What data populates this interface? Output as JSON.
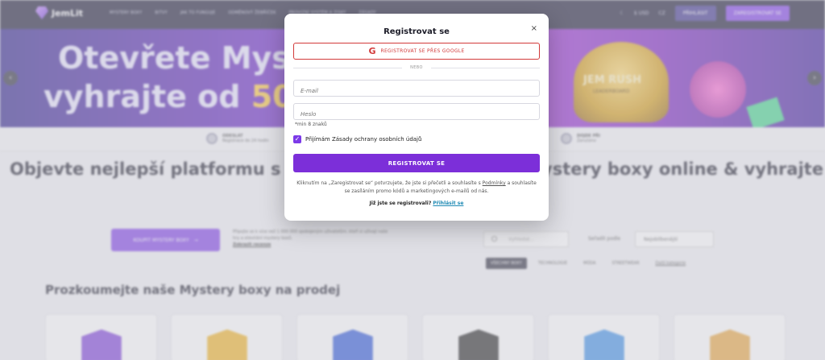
{
  "nav": {
    "logo_text": "JemLit",
    "items": [
      "Mystery boxy",
      "Bitvy",
      "Jak to funguje",
      "Odměnový žebříček",
      "Provizní systém a zisky",
      "Zásady"
    ],
    "currency": "$ USD",
    "language": "CZ",
    "login_label": "PŘIHLÁSIT",
    "register_label": "ZAREGISTROVAT SE"
  },
  "hero": {
    "line1": "Otevřete Myst",
    "line2_prefix": "vyhrajte od ",
    "line2_number": "50",
    "promo_title": "JEM RUSH",
    "promo_sub": "LEADERBOARD"
  },
  "steps": [
    {
      "title": "ODESLAT",
      "desc": "Registrace do 24 hodin"
    },
    {
      "title": "DOJDE PŘI",
      "desc": "Zaručeno"
    }
  ],
  "main": {
    "heading_left": "Objevte nejlepší platformu s",
    "heading_right": "ystery boxy online & vyhrajte",
    "buy_button": "KOUPIT MYSTERY BOXY",
    "buy_desc": "Připojte se k více než 1 000 000 spokojeným uživatelům, kteří si užívají naše hry a otevírání mystery boxů.",
    "buy_link": "Zobrazit recenze",
    "search_placeholder": "Vyhledat...",
    "sort_label": "Seřadit podle",
    "sort_value": "Nejoblíbenější",
    "filters": [
      "Všechny boxy",
      "Technologie",
      "Móda",
      "Streetwear"
    ],
    "filters_link": "Další kategorie",
    "section_heading": "Prozkoumejte naše Mystery boxy na prodej"
  },
  "cards": [
    {
      "color": "#7a3ad8"
    },
    {
      "color": "#f0b21e"
    },
    {
      "color": "#2a54d8"
    },
    {
      "color": "#222222"
    },
    {
      "color": "#3a8ee8"
    },
    {
      "color": "#e8a43a"
    }
  ],
  "modal": {
    "title": "Registrovat se",
    "close_label": "×",
    "google_label": "REGISTROVAT SE PŘES GOOGLE",
    "or_label": "NEBO",
    "email_placeholder": "E-mail",
    "password_placeholder": "Heslo",
    "password_hint": "*min 8 znaků",
    "checkbox_label": "Přijímám Zásady ochrany osobních údajů",
    "checkbox_checked": true,
    "submit_label": "REGISTROVAT SE",
    "terms_before": "Kliknutím na „Zaregistrovat se“ potvrzujete, že jste si přečetli a souhlasíte s ",
    "terms_link": "Podmínky",
    "terms_after": " a souhlasíte se zasíláním promo kódů a marketingových e-mailů od nás.",
    "already_text": "Již jste se registrovali? ",
    "login_link": "Přihlásit se"
  }
}
